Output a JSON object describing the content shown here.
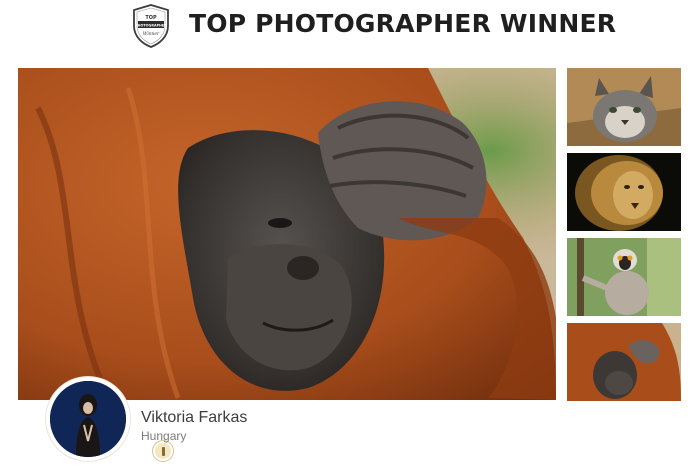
{
  "header": {
    "title": "TOP PHOTOGRAPHER WINNER",
    "badge_top": "TOP",
    "badge_middle": "PHOTOGRAPHER",
    "badge_script": "Winner"
  },
  "main_photo": {
    "subject": "orangutan"
  },
  "thumbnails": [
    {
      "subject": "lynx"
    },
    {
      "subject": "lion"
    },
    {
      "subject": "lemur"
    },
    {
      "subject": "orangutan"
    }
  ],
  "author": {
    "name": "Viktoria Farkas",
    "country": "Hungary"
  },
  "colors": {
    "title": "#1f1f1f",
    "orangutan_fur": "#b25520",
    "avatar_bg": "#11295c",
    "name": "#3d3d3d",
    "country": "#7b7b7b"
  },
  "icons": {
    "badge": "award-shield-icon",
    "medal": "medal-icon"
  }
}
